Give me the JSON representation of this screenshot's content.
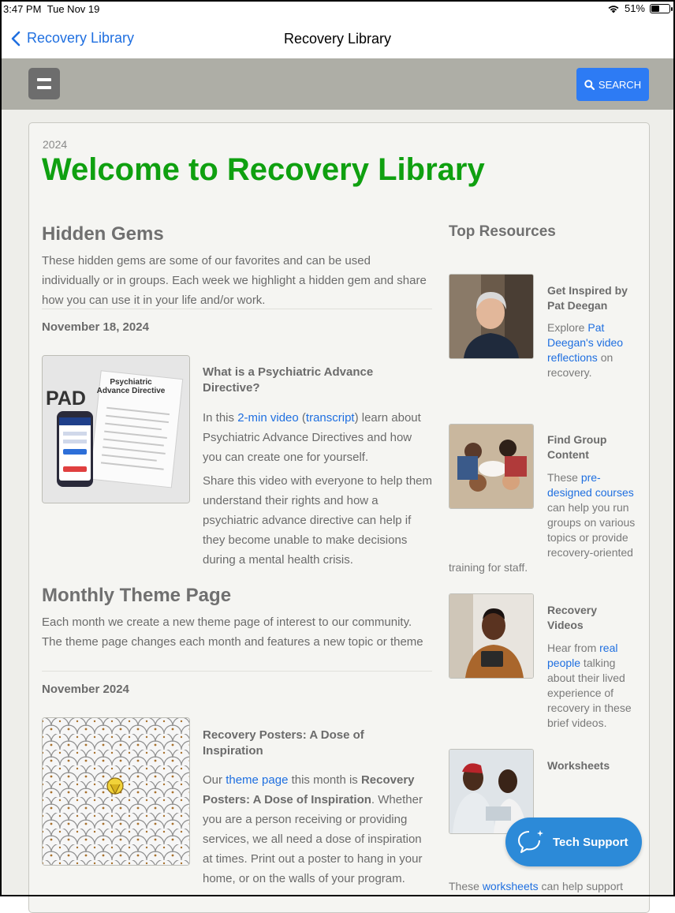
{
  "status": {
    "time": "3:47 PM",
    "date": "Tue Nov 19",
    "battery": "51%",
    "battery_level": 0.51
  },
  "nav": {
    "back_label": "Recovery Library",
    "title": "Recovery Library"
  },
  "header": {
    "search_label": "SEARCH"
  },
  "page": {
    "year": "2024",
    "title": "Welcome to Recovery Library"
  },
  "hidden_gems": {
    "heading": "Hidden Gems",
    "intro": "These hidden gems are some of our favorites and can be used individually or in groups. Each week we highlight a hidden gem and share how you can use it in your life and/or work.",
    "date": "November 18, 2024",
    "item": {
      "thumb_pad": "PAD",
      "thumb_title": "Psychiatric Advance Directive",
      "title": "What is a Psychiatric Advance Directive?",
      "p1_pre": "In this ",
      "p1_link1": "2-min video",
      "p1_mid": " (",
      "p1_link2": "transcript",
      "p1_post": ") learn about Psychiatric Advance Directives and how you can create one for yourself.",
      "p2": "Share this video with everyone to help them understand their rights and how a psychiatric advance directive can help if they become unable to make decisions during a mental health crisis."
    }
  },
  "monthly_theme": {
    "heading": "Monthly Theme Page",
    "intro": "Each month we create a new theme page of interest to our community. The theme page changes each month and features a new topic or theme",
    "date": "November 2024",
    "item": {
      "title": "Recovery Posters: A Dose of Inspiration",
      "p_pre": "Our ",
      "p_link": "theme page",
      "p_mid": " this month is ",
      "p_bold": "Recovery Posters: A Dose of Inspiration",
      "p_post": ". Whether you are a person receiving or providing services, we all need a dose of inspiration at times. Print out a poster to hang in your home, or on the walls of your program."
    }
  },
  "top_resources": {
    "heading": "Top Resources",
    "items": [
      {
        "title": "Get Inspired by Pat Deegan",
        "pre": "Explore ",
        "link": "Pat Deegan's video reflections",
        "post": " on recovery."
      },
      {
        "title": "Find Group Content",
        "pre": "These ",
        "link": "pre-designed courses",
        "post": " can help you run groups on various topics or provide recovery-oriented training for staff."
      },
      {
        "title": "Recovery Videos",
        "pre": "Hear from ",
        "link": "real people",
        "post": " talking about their lived experience of recovery in these brief videos."
      },
      {
        "title": "Worksheets",
        "pre": "These ",
        "link": "worksheets",
        "post": " can help support"
      }
    ]
  },
  "tech_support": {
    "label": "Tech Support"
  }
}
